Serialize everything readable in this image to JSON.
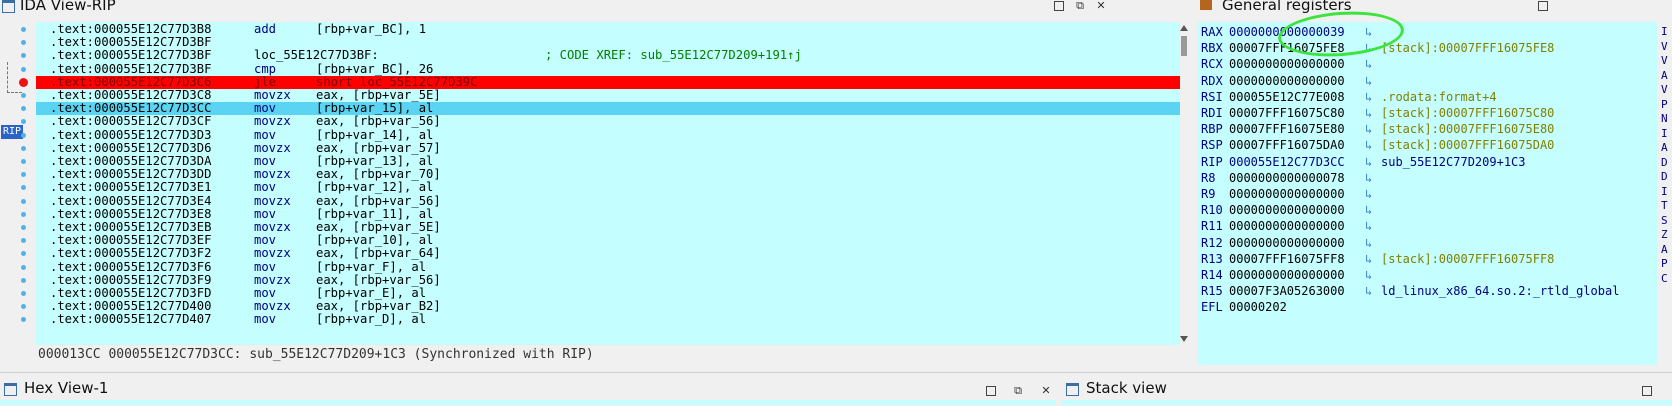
{
  "ida_view": {
    "title": "IDA View-RIP",
    "rip_label": "RIP",
    "status": "000013CC 000055E12C77D3CC: sub_55E12C77D209+1C3 (Synchronized with RIP)",
    "rows": [
      {
        "addr": ".text:000055E12C77D3B8",
        "mn": "add",
        "op": "[rbp+var_BC], 1",
        "cm": "",
        "hl": ""
      },
      {
        "addr": ".text:000055E12C77D3BF",
        "mn": "",
        "op": "",
        "cm": "",
        "hl": ""
      },
      {
        "addr": ".text:000055E12C77D3BF",
        "mn": "loc_55E12C77D3BF:",
        "op": "",
        "cm": "; CODE XREF: sub_55E12C77D209+191↑j",
        "hl": "",
        "label": true
      },
      {
        "addr": ".text:000055E12C77D3BF",
        "mn": "cmp",
        "op": "[rbp+var_BC], 26",
        "cm": "",
        "hl": ""
      },
      {
        "addr": ".text:000055E12C77D3C6",
        "mn": "jle",
        "op": "short loc_55E12C77D39C",
        "cm": "",
        "hl": "red"
      },
      {
        "addr": ".text:000055E12C77D3C8",
        "mn": "movzx",
        "op": "eax, [rbp+var_5E]",
        "cm": "",
        "hl": ""
      },
      {
        "addr": ".text:000055E12C77D3CC",
        "mn": "mov",
        "op": "[rbp+var_15], al",
        "cm": "",
        "hl": "blue"
      },
      {
        "addr": ".text:000055E12C77D3CF",
        "mn": "movzx",
        "op": "eax, [rbp+var_56]",
        "cm": "",
        "hl": ""
      },
      {
        "addr": ".text:000055E12C77D3D3",
        "mn": "mov",
        "op": "[rbp+var_14], al",
        "cm": "",
        "hl": ""
      },
      {
        "addr": ".text:000055E12C77D3D6",
        "mn": "movzx",
        "op": "eax, [rbp+var_57]",
        "cm": "",
        "hl": ""
      },
      {
        "addr": ".text:000055E12C77D3DA",
        "mn": "mov",
        "op": "[rbp+var_13], al",
        "cm": "",
        "hl": ""
      },
      {
        "addr": ".text:000055E12C77D3DD",
        "mn": "movzx",
        "op": "eax, [rbp+var_70]",
        "cm": "",
        "hl": ""
      },
      {
        "addr": ".text:000055E12C77D3E1",
        "mn": "mov",
        "op": "[rbp+var_12], al",
        "cm": "",
        "hl": ""
      },
      {
        "addr": ".text:000055E12C77D3E4",
        "mn": "movzx",
        "op": "eax, [rbp+var_56]",
        "cm": "",
        "hl": ""
      },
      {
        "addr": ".text:000055E12C77D3E8",
        "mn": "mov",
        "op": "[rbp+var_11], al",
        "cm": "",
        "hl": ""
      },
      {
        "addr": ".text:000055E12C77D3EB",
        "mn": "movzx",
        "op": "eax, [rbp+var_5E]",
        "cm": "",
        "hl": ""
      },
      {
        "addr": ".text:000055E12C77D3EF",
        "mn": "mov",
        "op": "[rbp+var_10], al",
        "cm": "",
        "hl": ""
      },
      {
        "addr": ".text:000055E12C77D3F2",
        "mn": "movzx",
        "op": "eax, [rbp+var_64]",
        "cm": "",
        "hl": ""
      },
      {
        "addr": ".text:000055E12C77D3F6",
        "mn": "mov",
        "op": "[rbp+var_F], al",
        "cm": "",
        "hl": ""
      },
      {
        "addr": ".text:000055E12C77D3F9",
        "mn": "movzx",
        "op": "eax, [rbp+var_56]",
        "cm": "",
        "hl": ""
      },
      {
        "addr": ".text:000055E12C77D3FD",
        "mn": "mov",
        "op": "[rbp+var_E], al",
        "cm": "",
        "hl": ""
      },
      {
        "addr": ".text:000055E12C77D400",
        "mn": "movzx",
        "op": "eax, [rbp+var_B2]",
        "cm": "",
        "hl": ""
      },
      {
        "addr": ".text:000055E12C77D407",
        "mn": "mov",
        "op": "[rbp+var_D], al",
        "cm": "",
        "hl": ""
      }
    ]
  },
  "registers": {
    "title": "General registers",
    "arrow_glyph": "↳",
    "rows": [
      {
        "name": "RAX",
        "value": "0000000000000039",
        "desc": "",
        "kind": "rax"
      },
      {
        "name": "RBX",
        "value": "00007FFF16075FE8",
        "desc": "[stack]:00007FFF16075FE8",
        "kind": "stack"
      },
      {
        "name": "RCX",
        "value": "0000000000000000",
        "desc": "",
        "kind": ""
      },
      {
        "name": "RDX",
        "value": "0000000000000000",
        "desc": "",
        "kind": ""
      },
      {
        "name": "RSI",
        "value": "000055E12C77E008",
        "desc": ".rodata:format+4",
        "kind": "stack"
      },
      {
        "name": "RDI",
        "value": "00007FFF16075C80",
        "desc": "[stack]:00007FFF16075C80",
        "kind": "stack"
      },
      {
        "name": "RBP",
        "value": "00007FFF16075E80",
        "desc": "[stack]:00007FFF16075E80",
        "kind": "stack"
      },
      {
        "name": "RSP",
        "value": "00007FFF16075DA0",
        "desc": "[stack]:00007FFF16075DA0",
        "kind": "stack"
      },
      {
        "name": "RIP",
        "value": "000055E12C77D3CC",
        "desc": "sub_55E12C77D209+1C3",
        "kind": "code"
      },
      {
        "name": "R8",
        "value": "0000000000000078",
        "desc": "",
        "kind": ""
      },
      {
        "name": "R9",
        "value": "0000000000000000",
        "desc": "",
        "kind": ""
      },
      {
        "name": "R10",
        "value": "0000000000000000",
        "desc": "",
        "kind": ""
      },
      {
        "name": "R11",
        "value": "0000000000000000",
        "desc": "",
        "kind": ""
      },
      {
        "name": "R12",
        "value": "0000000000000000",
        "desc": "",
        "kind": ""
      },
      {
        "name": "R13",
        "value": "00007FFF16075FF8",
        "desc": "[stack]:00007FFF16075FF8",
        "kind": "stack"
      },
      {
        "name": "R14",
        "value": "0000000000000000",
        "desc": "",
        "kind": ""
      },
      {
        "name": "R15",
        "value": "00007F3A05263000",
        "desc": "ld_linux_x86_64.so.2:_rtld_global",
        "kind": "mod"
      },
      {
        "name": "EFL",
        "value": "00000202",
        "desc": "",
        "kind": "efl"
      }
    ],
    "flags_strip": [
      "I",
      "V",
      "V",
      "A",
      "V",
      "P",
      "N",
      "I",
      "A",
      "D",
      "D",
      "I",
      "T",
      "S",
      "Z",
      "A",
      "P",
      "C"
    ]
  },
  "bottom": {
    "hex_view_title": "Hex View-1",
    "stack_view_title": "Stack view"
  },
  "colors": {
    "listing_bg": "#c4feff",
    "current_line": "#5ad4f2",
    "breakpoint_line": "#ff0000",
    "annotation_circle": "#3de43d"
  }
}
